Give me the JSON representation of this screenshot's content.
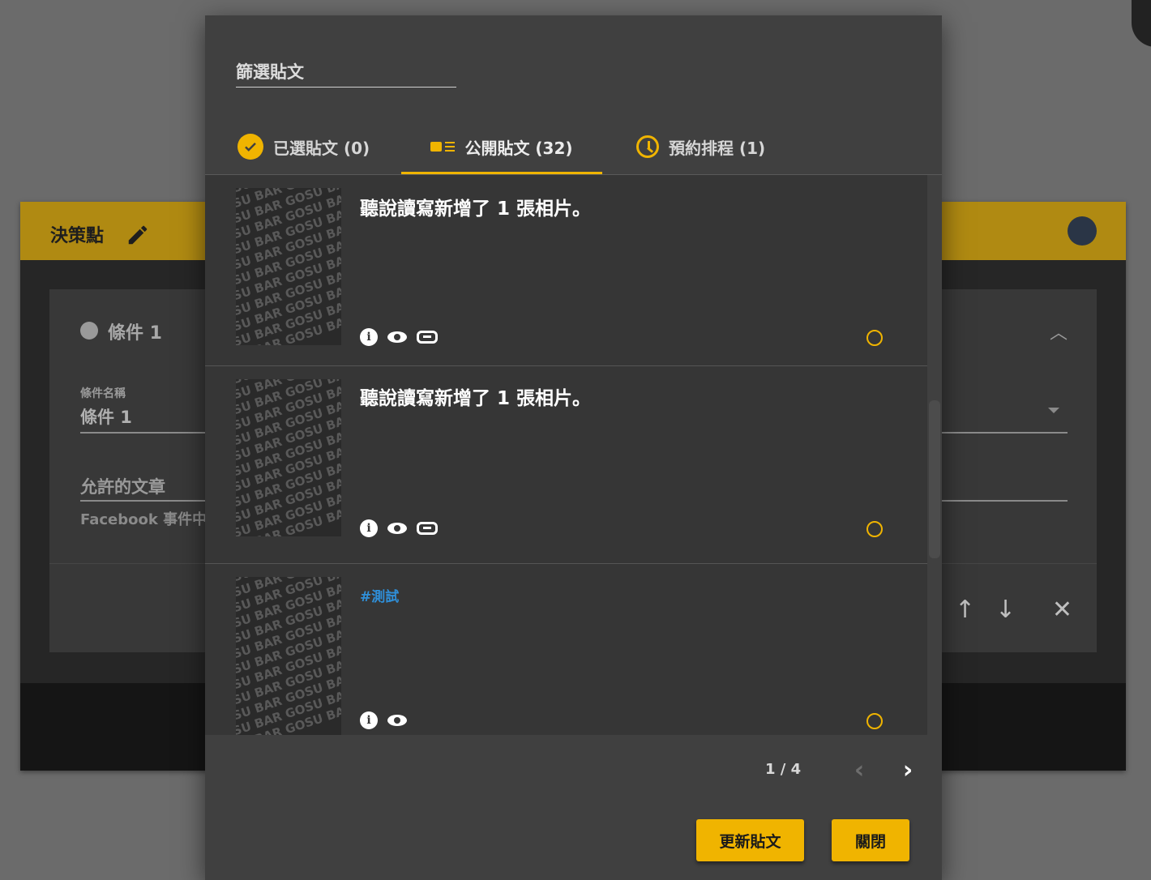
{
  "background": {
    "card_title": "決策點",
    "condition_title": "條件 1",
    "condition_name_label": "條件名稱",
    "condition_name_value": "條件 1",
    "allowed_posts_label": "允許的文章",
    "allowed_posts_hint": "Facebook 事件中，",
    "accent_color": "#f0b400"
  },
  "dialog": {
    "filter_placeholder": "篩選貼文",
    "tabs": [
      {
        "label": "已選貼文 (0)",
        "icon": "check-circle-icon"
      },
      {
        "label": "公開貼文 (32)",
        "icon": "media-list-icon",
        "active": true
      },
      {
        "label": "預約排程 (1)",
        "icon": "clock-icon"
      }
    ],
    "thumb_text": "GOSU BAR GOSU BAR GOSU BAR",
    "posts": [
      {
        "title": "聽說讀寫新增了 1 張相片。",
        "tag": "",
        "icons": [
          "info-icon",
          "eye-icon",
          "link-icon"
        ]
      },
      {
        "title": "聽說讀寫新增了 1 張相片。",
        "tag": "",
        "icons": [
          "info-icon",
          "eye-icon",
          "link-icon"
        ]
      },
      {
        "title": "",
        "tag": "#測試",
        "icons": [
          "info-icon",
          "eye-icon"
        ]
      }
    ],
    "pagination": "1 / 4",
    "buttons": {
      "update": "更新貼文",
      "close": "關閉"
    }
  }
}
